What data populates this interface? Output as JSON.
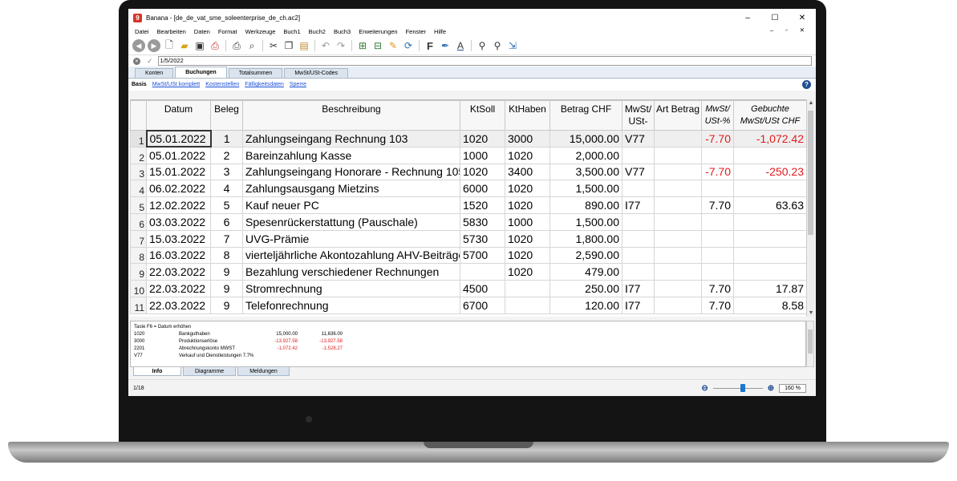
{
  "window": {
    "app_icon": "9",
    "title": "Banana - [de_de_vat_sme_soleenterprise_de_ch.ac2]",
    "minimize": "–",
    "maximize": "☐",
    "close": "✕"
  },
  "menu": [
    "Datei",
    "Bearbeiten",
    "Daten",
    "Format",
    "Werkzeuge",
    "Buch1",
    "Buch2",
    "Buch3",
    "Erweiterungen",
    "Fenster",
    "Hilfe"
  ],
  "mdi_controls": [
    "–",
    "▫",
    "✕"
  ],
  "cell_editor": {
    "cancel": "✕",
    "ok": "✓",
    "value": "1/5/2022"
  },
  "tabs": [
    "Konten",
    "Buchungen",
    "Totalsummen",
    "MwSt/USt-Codes"
  ],
  "views": [
    "Basis",
    "MwSt/USt komplett",
    "Kostenstellen",
    "Fälligkeitsdaten",
    "Sperre"
  ],
  "help": "?",
  "columns": [
    {
      "label": "Datum",
      "italic": false
    },
    {
      "label": "Beleg",
      "italic": false
    },
    {
      "label": "Beschreibung",
      "italic": false
    },
    {
      "label": "KtSoll",
      "italic": false
    },
    {
      "label": "KtHaben",
      "italic": false
    },
    {
      "label": "Betrag CHF",
      "italic": false
    },
    {
      "label": "MwSt/ USt-",
      "italic": false
    },
    {
      "label": "Art Betrag",
      "italic": false
    },
    {
      "label": "MwSt/ USt-%",
      "italic": true
    },
    {
      "label": "Gebuchte MwSt/USt CHF",
      "italic": true
    }
  ],
  "rows": [
    {
      "n": "1",
      "date": "05.01.2022",
      "doc": "1",
      "desc": "Zahlungseingang Rechnung 103",
      "debit": "1020",
      "credit": "3000",
      "amount": "15,000.00",
      "vat": "V77",
      "art": "",
      "pct": "-7.70",
      "posted": "-1,072.42"
    },
    {
      "n": "2",
      "date": "05.01.2022",
      "doc": "2",
      "desc": "Bareinzahlung Kasse",
      "debit": "1000",
      "credit": "1020",
      "amount": "2,000.00",
      "vat": "",
      "art": "",
      "pct": "",
      "posted": ""
    },
    {
      "n": "3",
      "date": "15.01.2022",
      "doc": "3",
      "desc": "Zahlungseingang Honorare - Rechnung 105",
      "debit": "1020",
      "credit": "3400",
      "amount": "3,500.00",
      "vat": "V77",
      "art": "",
      "pct": "-7.70",
      "posted": "-250.23"
    },
    {
      "n": "4",
      "date": "06.02.2022",
      "doc": "4",
      "desc": "Zahlungsausgang Mietzins",
      "debit": "6000",
      "credit": "1020",
      "amount": "1,500.00",
      "vat": "",
      "art": "",
      "pct": "",
      "posted": ""
    },
    {
      "n": "5",
      "date": "12.02.2022",
      "doc": "5",
      "desc": "Kauf neuer PC",
      "debit": "1520",
      "credit": "1020",
      "amount": "890.00",
      "vat": "I77",
      "art": "",
      "pct": "7.70",
      "posted": "63.63"
    },
    {
      "n": "6",
      "date": "03.03.2022",
      "doc": "6",
      "desc": "Spesenrückerstattung (Pauschale)",
      "debit": "5830",
      "credit": "1000",
      "amount": "1,500.00",
      "vat": "",
      "art": "",
      "pct": "",
      "posted": ""
    },
    {
      "n": "7",
      "date": "15.03.2022",
      "doc": "7",
      "desc": "UVG-Prämie",
      "debit": "5730",
      "credit": "1020",
      "amount": "1,800.00",
      "vat": "",
      "art": "",
      "pct": "",
      "posted": ""
    },
    {
      "n": "8",
      "date": "16.03.2022",
      "doc": "8",
      "desc": "vierteljährliche Akontozahlung AHV-Beiträge",
      "debit": "5700",
      "credit": "1020",
      "amount": "2,590.00",
      "vat": "",
      "art": "",
      "pct": "",
      "posted": ""
    },
    {
      "n": "9",
      "date": "22.03.2022",
      "doc": "9",
      "desc": "Bezahlung verschiedener Rechnungen",
      "debit": "",
      "credit": "1020",
      "amount": "479.00",
      "vat": "",
      "art": "",
      "pct": "",
      "posted": ""
    },
    {
      "n": "10",
      "date": "22.03.2022",
      "doc": "9",
      "desc": "Stromrechnung",
      "debit": "4500",
      "credit": "",
      "amount": "250.00",
      "vat": "I77",
      "art": "",
      "pct": "7.70",
      "posted": "17.87"
    },
    {
      "n": "11",
      "date": "22.03.2022",
      "doc": "9",
      "desc": "Telefonrechnung",
      "debit": "6700",
      "credit": "",
      "amount": "120.00",
      "vat": "I77",
      "art": "",
      "pct": "7.70",
      "posted": "8.58"
    }
  ],
  "info_panel": {
    "header": "Taste F6 = Datum erhöhen",
    "lines": [
      {
        "code": "1020",
        "name": "Bankguthaben",
        "a": "15,000.00",
        "b": "11,636.00",
        "neg": false
      },
      {
        "code": "3000",
        "name": "Produktionserlöse",
        "a": "-13,927.58",
        "b": "-13,927.58",
        "neg": true
      },
      {
        "code": "2201",
        "name": "Abrechnungskonto MWST",
        "a": "-1,072.42",
        "b": "-1,528.27",
        "neg": true
      },
      {
        "code": "V77",
        "name": "Verkauf und Dienstleistungen 7.7%",
        "a": "",
        "b": "",
        "neg": false
      }
    ]
  },
  "bottom_tabs": [
    "Info",
    "Diagramme",
    "Meldungen"
  ],
  "status": {
    "position": "1/18",
    "zoom": "160 %",
    "zoom_level": 0.55
  },
  "colors": {
    "negative": "#e21b1b",
    "tab_bg": "#dbe4ee",
    "link": "#1a4fd6"
  }
}
